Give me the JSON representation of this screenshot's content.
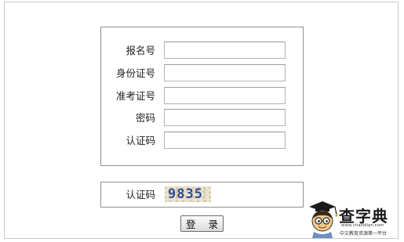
{
  "form": {
    "fields": [
      {
        "label": "报名号",
        "value": ""
      },
      {
        "label": "身份证号",
        "value": ""
      },
      {
        "label": "准考证号",
        "value": ""
      },
      {
        "label": "密码",
        "value": ""
      },
      {
        "label": "认证码",
        "value": ""
      }
    ]
  },
  "captcha": {
    "label": "认证码",
    "code": "9835"
  },
  "login_button": "登 录",
  "watermark": {
    "brand": "查字典",
    "url": "www.chazidian.com",
    "slogan": "中文教育资源第一平台"
  }
}
